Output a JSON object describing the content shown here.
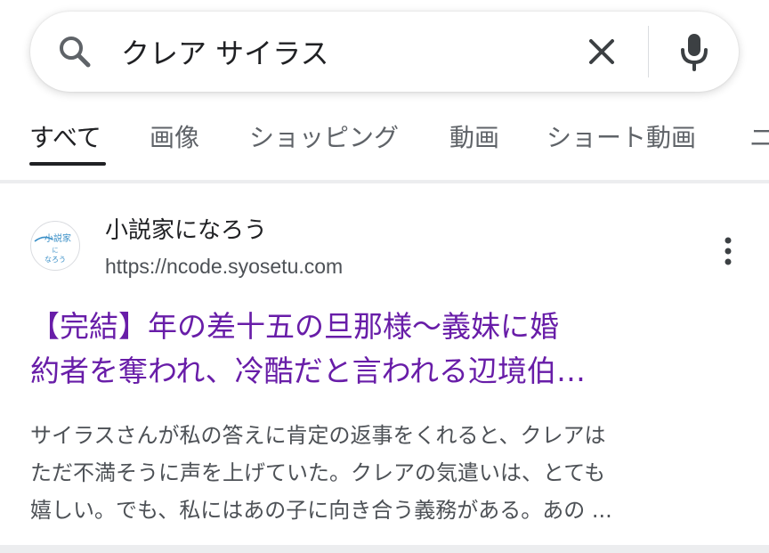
{
  "search": {
    "query": "クレア サイラス"
  },
  "tabs": [
    {
      "label": "すべて",
      "active": true
    },
    {
      "label": "画像",
      "active": false
    },
    {
      "label": "ショッピング",
      "active": false
    },
    {
      "label": "動画",
      "active": false
    },
    {
      "label": "ショート動画",
      "active": false
    },
    {
      "label": "ニ",
      "active": false
    }
  ],
  "result": {
    "site_name": "小説家になろう",
    "url": "https://ncode.syosetu.com",
    "favicon_text": [
      "小説家",
      "に",
      "なろう"
    ],
    "title_lines": [
      "【完結】年の差十五の旦那様〜義妹に婚",
      "約者を奪われ、冷酷だと言われる辺境伯…"
    ],
    "snippet_lines": [
      "サイラスさんが私の答えに肯定の返事をくれると、クレアは",
      "ただ不満そうに声を上げていた。クレアの気遣いは、とても",
      "嬉しい。でも、私にはあの子に向き合う義務がある。あの ..."
    ]
  },
  "colors": {
    "title_visited": "#681da8",
    "text_primary": "#202124",
    "text_secondary": "#5f6368",
    "snippet": "#4d5156",
    "favicon_accent": "#3a8fc7"
  },
  "icons": {
    "search": "search-icon",
    "clear": "close-icon",
    "mic": "mic-icon",
    "more": "more-vert-icon"
  }
}
